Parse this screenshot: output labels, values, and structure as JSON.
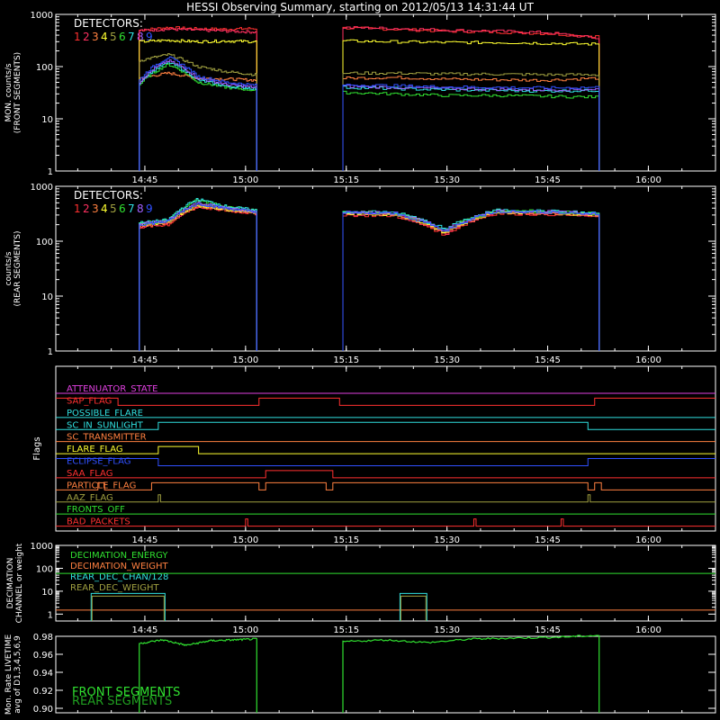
{
  "title": "HESSI Observing Summary, starting on 2012/05/13 14:31:44 UT",
  "colors": {
    "background": "#000000",
    "axes": "#ffffff",
    "det": [
      "#ff3030",
      "#ff3060",
      "#ff8040",
      "#ffff30",
      "#a0a040",
      "#30e030",
      "#30e0e0",
      "#a060ff",
      "#3050ff"
    ]
  },
  "chart_data": [
    {
      "type": "line",
      "ylabel": "MON. counts/s\n(FRONT SEGMENTS)",
      "yscale": "log",
      "ylim": [
        1,
        1000
      ],
      "yticks": [
        "1",
        "10",
        "100",
        "1000"
      ],
      "xticks": [
        "14:45",
        "15:00",
        "15:15",
        "15:30",
        "15:45",
        "16:00"
      ],
      "legend_title": "DETECTORS:",
      "legend_digits": [
        "1",
        "2",
        "3",
        "4",
        "5",
        "6",
        "7",
        "8",
        "9"
      ],
      "segments": [
        [
          "14:44:10",
          "15:01:40"
        ],
        [
          "15:14:30",
          "15:52:40"
        ]
      ],
      "series": [
        {
          "label": "1",
          "values_seg1": [
            500,
            560,
            530,
            520,
            540
          ],
          "values_seg2": [
            550,
            520,
            480,
            460,
            430,
            380
          ]
        },
        {
          "label": "2",
          "values_seg1": [
            490,
            520,
            500,
            480,
            460
          ],
          "values_seg2": [
            560,
            540,
            500,
            480,
            450,
            350
          ]
        },
        {
          "label": "3",
          "values_seg1": [
            60,
            75,
            60,
            58,
            55
          ],
          "values_seg2": [
            60,
            62,
            58,
            56,
            55,
            60
          ]
        },
        {
          "label": "4",
          "values_seg1": [
            300,
            320,
            300,
            310,
            300
          ],
          "values_seg2": [
            310,
            300,
            290,
            290,
            280,
            270
          ]
        },
        {
          "label": "5",
          "values_seg1": [
            130,
            170,
            100,
            80,
            70
          ],
          "values_seg2": [
            75,
            75,
            72,
            72,
            70,
            70
          ]
        },
        {
          "label": "6",
          "values_seg1": [
            45,
            110,
            50,
            40,
            35
          ],
          "values_seg2": [
            32,
            30,
            28,
            28,
            27,
            26
          ]
        },
        {
          "label": "7",
          "values_seg1": [
            50,
            120,
            55,
            42,
            38
          ],
          "values_seg2": [
            40,
            38,
            36,
            35,
            34,
            35
          ]
        },
        {
          "label": "8",
          "values_seg1": [
            50,
            130,
            60,
            45,
            40
          ],
          "values_seg2": [
            42,
            40,
            38,
            37,
            36,
            37
          ]
        },
        {
          "label": "9",
          "values_seg1": [
            55,
            150,
            65,
            50,
            44
          ],
          "values_seg2": [
            45,
            43,
            41,
            40,
            39,
            40
          ]
        }
      ]
    },
    {
      "type": "line",
      "ylabel": "counts/s\n(REAR SEGMENTS)",
      "yscale": "log",
      "ylim": [
        1,
        1000
      ],
      "yticks": [
        "1",
        "10",
        "100",
        "1000"
      ],
      "xticks": [
        "14:45",
        "15:00",
        "15:15",
        "15:30",
        "15:45",
        "16:00"
      ],
      "legend_title": "DETECTORS:",
      "legend_digits": [
        "1",
        "2",
        "3",
        "4",
        "5",
        "6",
        "7",
        "8",
        "9"
      ],
      "segments": [
        [
          "14:44:10",
          "15:01:40"
        ],
        [
          "15:14:30",
          "15:52:40"
        ]
      ],
      "series": [
        {
          "label": "1",
          "values_seg1": [
            180,
            200,
            420,
            360,
            320
          ],
          "values_seg2": [
            300,
            290,
            130,
            320,
            310,
            290
          ]
        },
        {
          "label": "2",
          "values_seg1": [
            185,
            210,
            430,
            370,
            330
          ],
          "values_seg2": [
            310,
            300,
            135,
            330,
            320,
            295
          ]
        },
        {
          "label": "3",
          "values_seg1": [
            190,
            215,
            440,
            375,
            335
          ],
          "values_seg2": [
            315,
            305,
            140,
            335,
            325,
            300
          ]
        },
        {
          "label": "4",
          "values_seg1": [
            195,
            220,
            450,
            380,
            340
          ],
          "values_seg2": [
            320,
            310,
            145,
            340,
            330,
            305
          ]
        },
        {
          "label": "5",
          "values_seg1": [
            200,
            230,
            470,
            390,
            345
          ],
          "values_seg2": [
            325,
            315,
            150,
            345,
            335,
            310
          ]
        },
        {
          "label": "6",
          "values_seg1": [
            210,
            240,
            560,
            420,
            360
          ],
          "values_seg2": [
            340,
            330,
            160,
            360,
            350,
            320
          ]
        },
        {
          "label": "7",
          "values_seg1": [
            215,
            245,
            580,
            430,
            365
          ],
          "values_seg2": [
            345,
            335,
            165,
            365,
            355,
            325
          ]
        },
        {
          "label": "8",
          "values_seg1": [
            205,
            235,
            500,
            400,
            350
          ],
          "values_seg2": [
            335,
            325,
            155,
            355,
            345,
            315
          ]
        },
        {
          "label": "9",
          "values_seg1": [
            200,
            230,
            480,
            395,
            348
          ],
          "values_seg2": [
            330,
            320,
            150,
            350,
            340,
            312
          ]
        }
      ]
    },
    {
      "type": "line",
      "ylabel": "Flags",
      "xticks": [
        "14:45",
        "15:00",
        "15:15",
        "15:30",
        "15:45",
        "16:00"
      ],
      "flags": [
        {
          "name": "ATTENUATOR_STATE",
          "color": "#e040e0"
        },
        {
          "name": "SAP_FLAG",
          "color": "#ff3030"
        },
        {
          "name": "POSSIBLE_FLARE",
          "color": "#30e0e0"
        },
        {
          "name": "SC_IN_SUNLIGHT",
          "color": "#30e0e0"
        },
        {
          "name": "SC_TRANSMITTER",
          "color": "#ff8040"
        },
        {
          "name": "FLARE_FLAG",
          "color": "#ffff30"
        },
        {
          "name": "ECLIPSE_FLAG",
          "color": "#3050ff"
        },
        {
          "name": "SAA_FLAG",
          "color": "#ff3030"
        },
        {
          "name": "PARTICLE_FLAG",
          "color": "#ff8040"
        },
        {
          "name": "AAZ_FLAG",
          "color": "#a0a040"
        },
        {
          "name": "FRONTS_OFF",
          "color": "#30e030"
        },
        {
          "name": "BAD_PACKETS",
          "color": "#ff3030"
        }
      ]
    },
    {
      "type": "line",
      "ylabel": "DECIMATION\nCHANNEL or weight",
      "yscale": "log",
      "ylim": [
        0.5,
        1000
      ],
      "yticks": [
        "1",
        "10",
        "100",
        "1000"
      ],
      "xticks": [
        "14:45",
        "15:00",
        "15:15",
        "15:30",
        "15:45",
        "16:00"
      ],
      "legend": [
        {
          "name": "DECIMATION_ENERGY",
          "color": "#30e030"
        },
        {
          "name": "DECIMATION_WEIGHT",
          "color": "#ff8040"
        },
        {
          "name": "REAR_DEC_CHAN/128",
          "color": "#30e0e0"
        },
        {
          "name": "REAR_DEC_WEIGHT",
          "color": "#a0a040"
        }
      ],
      "decimation_energy": 60,
      "decimation_weight": 1.5,
      "rear_boxes": [
        [
          "14:37",
          "14:48",
          8
        ],
        [
          "15:23",
          "15:27",
          8
        ]
      ]
    },
    {
      "type": "line",
      "ylabel": "Mon. Rate LIVETIME\navg of D1,3,4,5,6,9",
      "ylim": [
        0.895,
        0.98
      ],
      "yticks": [
        "0.90",
        "0.92",
        "0.94",
        "0.96",
        "0.98"
      ],
      "legend": [
        {
          "name": "FRONT SEGMENTS",
          "color": "#30e030"
        },
        {
          "name": "REAR SEGMENTS",
          "color": "#20a020"
        }
      ],
      "segments": [
        [
          "14:44:10",
          "15:01:40"
        ],
        [
          "15:14:30",
          "15:52:40"
        ]
      ],
      "values_seg1": [
        0.972,
        0.976,
        0.97,
        0.975,
        0.976,
        0.977
      ],
      "values_seg2": [
        0.974,
        0.976,
        0.973,
        0.977,
        0.978,
        0.979,
        0.981
      ]
    }
  ]
}
